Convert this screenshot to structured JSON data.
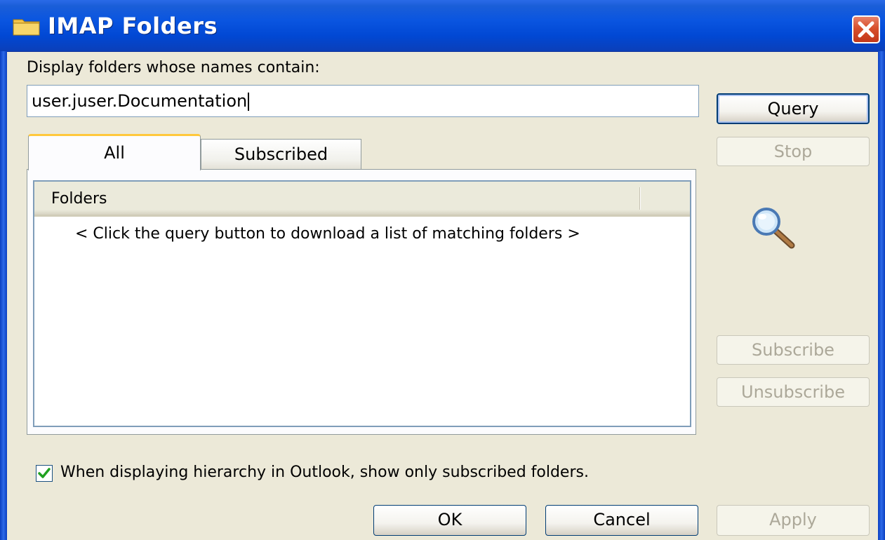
{
  "window": {
    "title": "IMAP Folders",
    "icon": "folder-icon",
    "close_icon": "close-icon"
  },
  "search": {
    "label": "Display folders whose names contain:",
    "value": "user.juser.Documentation"
  },
  "buttons": {
    "query": "Query",
    "stop": "Stop",
    "subscribe": "Subscribe",
    "unsubscribe": "Unsubscribe",
    "ok": "OK",
    "cancel": "Cancel",
    "apply": "Apply"
  },
  "tabs": [
    {
      "label": "All",
      "selected": true
    },
    {
      "label": "Subscribed",
      "selected": false
    }
  ],
  "folder_list": {
    "column_header": "Folders",
    "empty_message": "< Click the query button to download a list of matching folders >"
  },
  "side_icon": "magnifier-icon",
  "subscribed_only": {
    "label": "When displaying hierarchy in Outlook, show only subscribed folders.",
    "checked": true
  },
  "colors": {
    "titlebar": "#0148d4",
    "dialog_bg": "#ece9d8",
    "active_tab_accent": "#ffc83c",
    "close_button": "#d8502c",
    "checkmark": "#21a121"
  }
}
